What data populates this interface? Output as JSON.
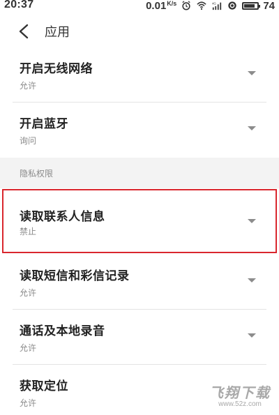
{
  "status_bar": {
    "time": "20:37",
    "speed": "0.01",
    "speed_unit": "K/s",
    "battery": "74"
  },
  "header": {
    "title": "应用"
  },
  "list": {
    "items": [
      {
        "title": "开启无线网络",
        "value": "允许"
      },
      {
        "title": "开启蓝牙",
        "value": "询问"
      }
    ],
    "section_label": "隐私权限",
    "privacy_items": [
      {
        "title": "读取联系人信息",
        "value": "禁止",
        "highlighted": true
      },
      {
        "title": "读取短信和彩信记录",
        "value": "允许"
      },
      {
        "title": "通话及本地录音",
        "value": "允许"
      },
      {
        "title": "获取定位",
        "value": "允许"
      }
    ]
  },
  "watermark": {
    "text": "飞翔下载",
    "url": "www.52z.com"
  },
  "colors": {
    "highlight_border": "#d9262d",
    "section_bg": "#f3f3f3",
    "caret": "#8c8c8c"
  }
}
